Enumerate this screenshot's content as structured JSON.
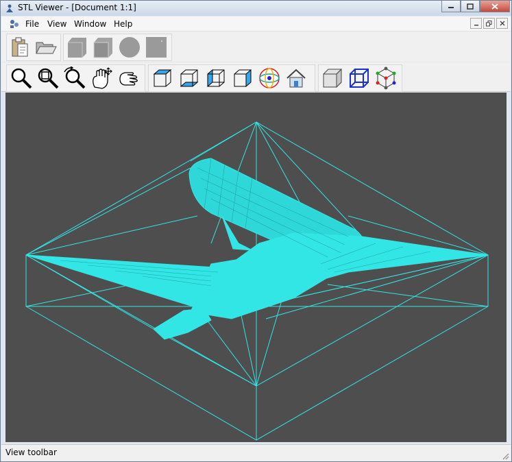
{
  "window": {
    "title": "STL Viewer - [Document 1:1]",
    "controls": [
      "minimize",
      "maximize",
      "close"
    ]
  },
  "menubar": {
    "items": [
      "File",
      "View",
      "Window",
      "Help"
    ]
  },
  "toolbar_file": [
    {
      "name": "paste-button",
      "icon": "clipboard-icon"
    },
    {
      "name": "open-button",
      "icon": "folder-open-icon"
    },
    {
      "name": "box-button",
      "icon": "box-gray-icon"
    },
    {
      "name": "box-front-button",
      "icon": "box-front-icon"
    },
    {
      "name": "sphere-button",
      "icon": "sphere-icon"
    },
    {
      "name": "blank-button",
      "icon": "blank-square-icon"
    }
  ],
  "toolbar_view": [
    {
      "name": "zoom-button",
      "icon": "magnifier-icon"
    },
    {
      "name": "zoom-window-button",
      "icon": "zoom-window-icon"
    },
    {
      "name": "zoom-dynamic-button",
      "icon": "zoom-rotate-icon"
    },
    {
      "name": "pan-button",
      "icon": "hand-move-icon"
    },
    {
      "name": "rotate-button",
      "icon": "hand-rotate-icon"
    },
    {
      "name": "view-top-button",
      "icon": "view-top-icon"
    },
    {
      "name": "view-bottom-button",
      "icon": "view-bottom-icon"
    },
    {
      "name": "view-left-button",
      "icon": "view-left-icon"
    },
    {
      "name": "view-right-button",
      "icon": "view-right-icon"
    },
    {
      "name": "view-axes-button",
      "icon": "axis-globe-icon"
    },
    {
      "name": "view-home-button",
      "icon": "home-icon"
    },
    {
      "name": "shaded-button",
      "icon": "cube-shaded-icon"
    },
    {
      "name": "wireframe-button",
      "icon": "cube-wireframe-icon"
    },
    {
      "name": "points-button",
      "icon": "cube-points-icon"
    }
  ],
  "viewport": {
    "background": "#4e4e4e",
    "wire_color": "#33e6e6",
    "model": "wireframe-aircraft"
  },
  "status": {
    "text": "View toolbar"
  }
}
